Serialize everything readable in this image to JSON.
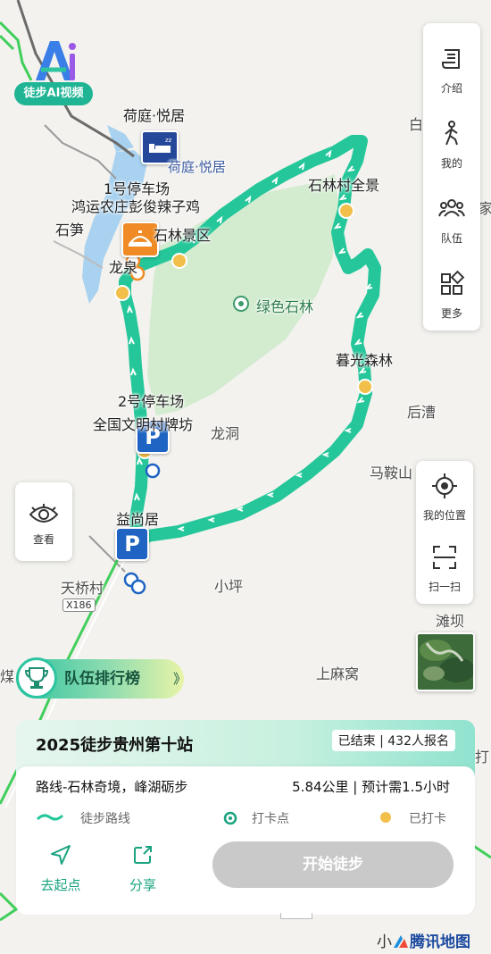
{
  "app": {
    "badge_label": "徒步AI视频"
  },
  "map": {
    "poi_labels": {
      "heting_top": "荷庭·悦居",
      "heting_side": "荷庭·悦居",
      "parking1": "1号停车场",
      "restaurant": "鸿运农庄彭俊辣子鸡",
      "shisun": "石笋",
      "shilin_scenic": "石林景区",
      "longquan": "龙泉",
      "lvse_shilin": "绿色石林",
      "shilin_village": "石林村全景",
      "muguang": "暮光森林",
      "parking2": "2号停车场",
      "wenming": "全国文明村牌坊",
      "longdong": "龙洞",
      "houcao": "后漕",
      "maanshan": "马鞍山",
      "yishangju": "益尚居",
      "tianqiao": "天桥村",
      "xiaoping": "小坪",
      "tanba": "滩坝",
      "shangmawo": "上麻窝",
      "bai": "白",
      "jia": "家",
      "mei": "煤",
      "ding": "打"
    },
    "road_badge": "X186",
    "credit_prefix": "小",
    "credit_brand": "腾讯地图"
  },
  "toolbar": {
    "intro": "介绍",
    "mine": "我的",
    "team": "队伍",
    "more": "更多",
    "my_location": "我的位置",
    "scan": "扫一扫",
    "view": "查看"
  },
  "leaderboard": {
    "label": "队伍排行榜",
    "chevron": "》"
  },
  "event": {
    "title": "2025徒步贵州第十站",
    "status": "已结束 | 432人报名",
    "route_name": "路线-石林奇境，峰湖砺步",
    "route_meta": "5.84公里 | 预计需1.5小时",
    "legend_route": "徒步路线",
    "legend_checkpoint": "打卡点",
    "legend_checked": "已打卡",
    "go_start": "去起点",
    "share": "分享",
    "start_button": "开始徒步"
  },
  "colors": {
    "route": "#25c79a",
    "accent": "#19a37f",
    "checked": "#f2c04a",
    "parking": "#1f64c2"
  }
}
